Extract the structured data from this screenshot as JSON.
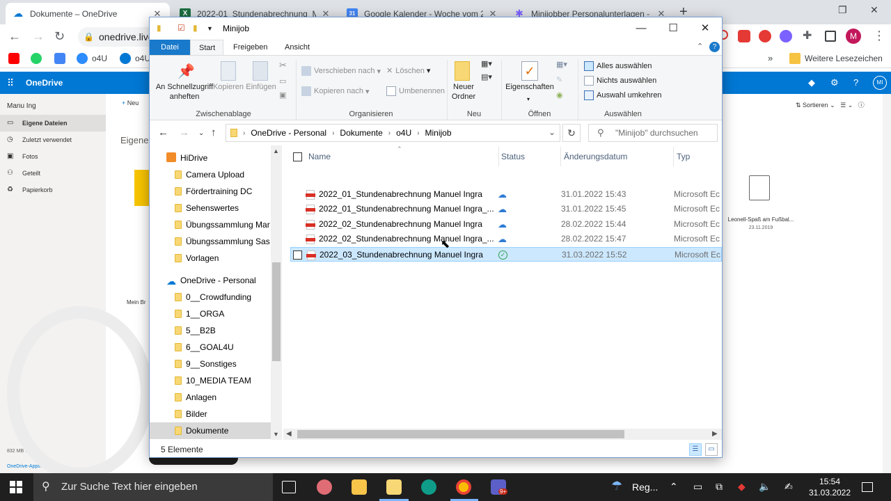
{
  "browser": {
    "tabs": [
      {
        "title": "Dokumente – OneDrive",
        "favicon": "onedrive-cloud-icon",
        "color": "#0078d4",
        "glyph": "☁"
      },
      {
        "title": "2022-01_Stundenabrechnung_M",
        "favicon": "excel-icon",
        "color": "#1d6f42",
        "glyph": "X"
      },
      {
        "title": "Google Kalender - Woche vom 2",
        "favicon": "calendar-icon",
        "color": "#4285f4",
        "glyph": "31"
      },
      {
        "title": "Minijobber Personalunterlagen -",
        "favicon": "asterisk-icon",
        "color": "#7b61ff",
        "glyph": "✱"
      }
    ],
    "new_tab": "+",
    "url": "onedrive.live",
    "bookmarks": [
      {
        "label": "",
        "icon": "youtube-icon",
        "color": "#ff0000"
      },
      {
        "label": "",
        "icon": "whatsapp-icon",
        "color": "#25d366"
      },
      {
        "label": "",
        "icon": "calendar-icon",
        "color": "#4285f4"
      },
      {
        "label": "o4U",
        "icon": "zoom-icon",
        "color": "#2d8cff"
      },
      {
        "label": "o4U",
        "icon": "onedrive-icon",
        "color": "#0078d4"
      }
    ],
    "other_bookmarks": "Weitere Lesezeichen",
    "profile_initial": "M"
  },
  "onedrive": {
    "brand": "OneDrive",
    "user": "Manu Ing",
    "nav": [
      "Eigene Dateien",
      "Zuletzt verwendet",
      "Fotos",
      "Geteilt",
      "Papierkorb"
    ],
    "new_label": "Neu",
    "page_title": "Eigene D",
    "thumb_caption": "Mein Br",
    "sort_label": "Sortieren",
    "file_name": "Leonell-Spaß am Fußbal...",
    "file_date": "23.11.2019",
    "storage": "832 MB ver",
    "apps_link": "OneDrive-Apps herunte...",
    "avatar": "MI"
  },
  "explorer": {
    "title": "Minijob",
    "ribbon_tabs": [
      "Datei",
      "Start",
      "Freigeben",
      "Ansicht"
    ],
    "groups": {
      "clipboard": {
        "label": "Zwischenablage",
        "pin": "An Schnellzugriff anheften",
        "copy": "Kopieren",
        "paste": "Einfügen"
      },
      "organize": {
        "label": "Organisieren",
        "move": "Verschieben nach",
        "copy_to": "Kopieren nach",
        "delete": "Löschen",
        "rename": "Umbenennen"
      },
      "new": {
        "label": "Neu",
        "new_folder": "Neuer Ordner"
      },
      "open": {
        "label": "Öffnen",
        "properties": "Eigenschaften"
      },
      "select": {
        "label": "Auswählen",
        "all": "Alles auswählen",
        "none": "Nichts auswählen",
        "invert": "Auswahl umkehren"
      }
    },
    "breadcrumb": [
      "OneDrive - Personal",
      "Dokumente",
      "o4U",
      "Minijob"
    ],
    "search_placeholder": "\"Minijob\" durchsuchen",
    "nav_items": [
      {
        "label": "HiDrive",
        "type": "drive",
        "level": 0
      },
      {
        "label": "Camera Upload",
        "type": "folder",
        "level": 1
      },
      {
        "label": "Fördertraining DC",
        "type": "folder",
        "level": 1
      },
      {
        "label": "Sehenswertes",
        "type": "folder",
        "level": 1
      },
      {
        "label": "Übungssammlung Mar",
        "type": "folder",
        "level": 1
      },
      {
        "label": "Übungssammlung Sas",
        "type": "folder",
        "level": 1
      },
      {
        "label": "Vorlagen",
        "type": "folder",
        "level": 1
      },
      {
        "label": "",
        "type": "spacer",
        "level": 0
      },
      {
        "label": "OneDrive - Personal",
        "type": "cloud",
        "level": 0
      },
      {
        "label": "0__Crowdfunding",
        "type": "folder",
        "level": 1
      },
      {
        "label": "1__ORGA",
        "type": "folder",
        "level": 1
      },
      {
        "label": "5__B2B",
        "type": "folder",
        "level": 1
      },
      {
        "label": "6__GOAL4U",
        "type": "folder",
        "level": 1
      },
      {
        "label": "9__Sonstiges",
        "type": "folder",
        "level": 1
      },
      {
        "label": "10_MEDIA TEAM",
        "type": "folder",
        "level": 1
      },
      {
        "label": "Anlagen",
        "type": "folder",
        "level": 1
      },
      {
        "label": "Bilder",
        "type": "folder",
        "level": 1
      },
      {
        "label": "Dokumente",
        "type": "folder",
        "level": 1,
        "selected": true
      }
    ],
    "columns": {
      "name": "Name",
      "status": "Status",
      "date": "Änderungsdatum",
      "type": "Typ"
    },
    "files": [
      {
        "name": "2022_01_Stundenabrechnung Manuel Ingra",
        "status": "cloud",
        "date": "31.01.2022 15:43",
        "type": "Microsoft Ec"
      },
      {
        "name": "2022_01_Stundenabrechnung Manuel Ingra_...",
        "status": "cloud",
        "date": "31.01.2022 15:45",
        "type": "Microsoft Ec"
      },
      {
        "name": "2022_02_Stundenabrechnung Manuel Ingra",
        "status": "cloud",
        "date": "28.02.2022 15:44",
        "type": "Microsoft Ec"
      },
      {
        "name": "2022_02_Stundenabrechnung Manuel Ingra_...",
        "status": "cloud",
        "date": "28.02.2022 15:47",
        "type": "Microsoft Ec"
      },
      {
        "name": "2022_03_Stundenabrechnung Manuel Ingra",
        "status": "synced",
        "date": "31.03.2022 15:52",
        "type": "Microsoft Ec",
        "selected": true
      }
    ],
    "status_count": "5 Elemente"
  },
  "taskbar": {
    "search_placeholder": "Zur Suche Text hier eingeben",
    "weather": "Reg...",
    "teams_badge": "9+",
    "time": "15:54",
    "date": "31.03.2022"
  }
}
